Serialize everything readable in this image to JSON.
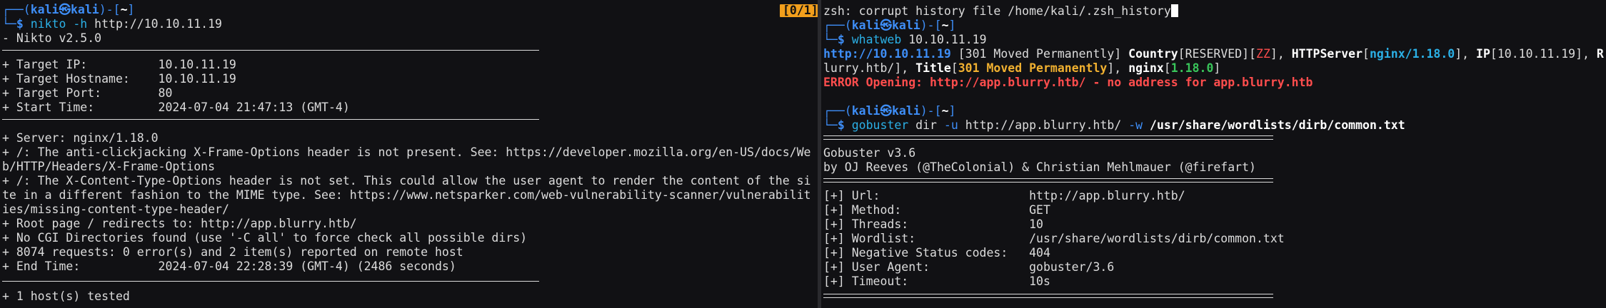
{
  "colors": {
    "background": "#111114",
    "prompt_blue": "#3e8ef7",
    "error_red": "#ff4d4d",
    "badge_orange": "#f29f1c",
    "cyan": "#2bb0e6",
    "green": "#39c45a"
  },
  "left": {
    "badge": "[0/1]",
    "prompt": {
      "user": "kali",
      "host": "kali",
      "dir": "~",
      "command": "nikto",
      "args": " -h ",
      "target": "http://10.10.11.19"
    },
    "lines": [
      "- Nikto v2.5.0",
      "+ Target IP:          10.10.11.19",
      "+ Target Hostname:    10.10.11.19",
      "+ Target Port:        80",
      "+ Start Time:         2024-07-04 21:47:13 (GMT-4)",
      "+ Server: nginx/1.18.0",
      "+ /: The anti-clickjacking X-Frame-Options header is not present. See: https://developer.mozilla.org/en-US/docs/We",
      "b/HTTP/Headers/X-Frame-Options",
      "+ /: The X-Content-Type-Options header is not set. This could allow the user agent to render the content of the si",
      "te in a different fashion to the MIME type. See: https://www.netsparker.com/web-vulnerability-scanner/vulnerabilit",
      "ies/missing-content-type-header/",
      "+ Root page / redirects to: http://app.blurry.htb/",
      "+ No CGI Directories found (use '-C all' to force check all possible dirs)",
      "+ 8074 requests: 0 error(s) and 2 item(s) reported on remote host",
      "+ End Time:           2024-07-04 22:28:39 (GMT-4) (2486 seconds)",
      "+ 1 host(s) tested"
    ]
  },
  "right": {
    "history_error": "zsh: corrupt history file /home/kali/.zsh_history",
    "prompt1": {
      "user": "kali",
      "host": "kali",
      "dir": "~",
      "command": "whatweb",
      "args": " 10.10.11.19"
    },
    "whatweb": {
      "url": "http://10.10.11.19",
      "status": " [301 Moved Permanently] ",
      "country_key": "Country",
      "country_val": "RESERVED",
      "country_code": "ZZ",
      "server_key": "HTTPServer",
      "server_val": "nginx/1.18.0",
      "ip_key": "IP",
      "ip_val": "10.10.11.19",
      "redirect_tail": "lurry.htb/], ",
      "title_key": "Title",
      "title_val": "301 Moved Permanently",
      "nginx_key": "nginx",
      "nginx_val": "1.18.0",
      "error": "ERROR Opening: http://app.blurry.htb/ - no address for app.blurry.htb"
    },
    "prompt2": {
      "user": "kali",
      "host": "kali",
      "dir": "~",
      "command": "gobuster",
      "args": " dir ",
      "flag_u": "-u",
      "url": " http://app.blurry.htb/ ",
      "flag_w": "-w",
      "wordlist": " /usr/share/wordlists/dirb/common.txt"
    },
    "gobuster": {
      "version": "Gobuster v3.6",
      "byline": "by OJ Reeves (@TheColonial) & Christian Mehlmauer (@firefart)",
      "config": [
        "[+] Url:                     http://app.blurry.htb/",
        "[+] Method:                  GET",
        "[+] Threads:                 10",
        "[+] Wordlist:                /usr/share/wordlists/dirb/common.txt",
        "[+] Negative Status codes:   404",
        "[+] User Agent:              gobuster/3.6",
        "[+] Timeout:                 10s"
      ]
    }
  }
}
